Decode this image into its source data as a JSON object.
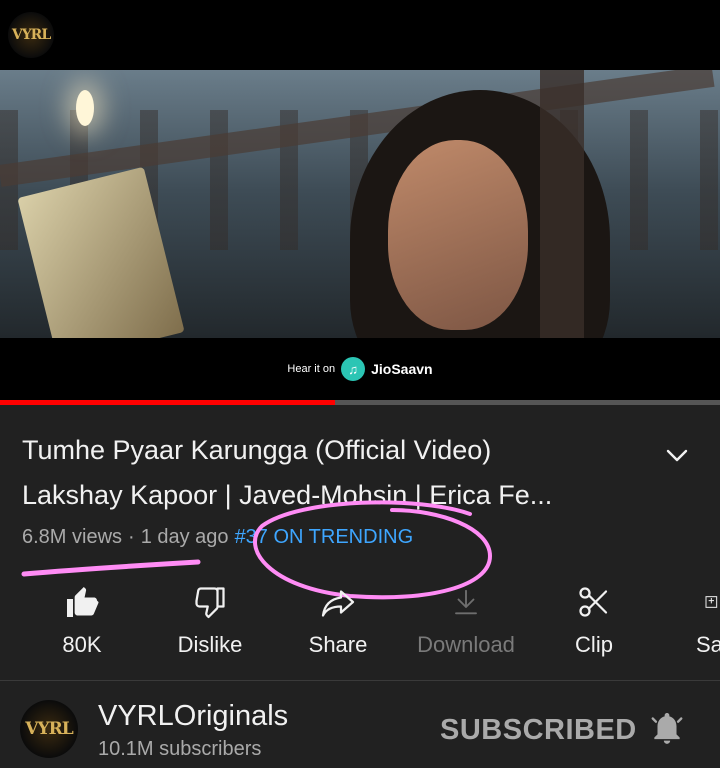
{
  "channel_logo_text": "VYRL",
  "banner": {
    "hear_text": "Hear it on",
    "service_name": "JioSaavn"
  },
  "player": {
    "progress": 0.465,
    "progress_color": "#ff0000"
  },
  "video": {
    "title": "Tumhe Pyaar Karungga (Official Video)\nLakshay Kapoor | Javed-Mohsin | Erica Fe...",
    "views": "6.8M views",
    "separator": "·",
    "age": "1 day ago",
    "trending": "#37 ON TRENDING"
  },
  "actions": [
    {
      "label": "80K",
      "icon": "thumbs-up-filled-icon"
    },
    {
      "label": "Dislike",
      "icon": "thumbs-down-icon"
    },
    {
      "label": "Share",
      "icon": "share-icon"
    },
    {
      "label": "Download",
      "icon": "download-icon",
      "disabled": true
    },
    {
      "label": "Clip",
      "icon": "scissors-icon"
    },
    {
      "label": "Sa",
      "icon": "save-icon"
    }
  ],
  "channel": {
    "name": "VYRLOriginals",
    "subscribers": "10.1M subscribers",
    "subscribe_state": "SUBSCRIBED"
  },
  "colors": {
    "trending": "#3ea6ff",
    "annotation": "#ff8cf5"
  }
}
